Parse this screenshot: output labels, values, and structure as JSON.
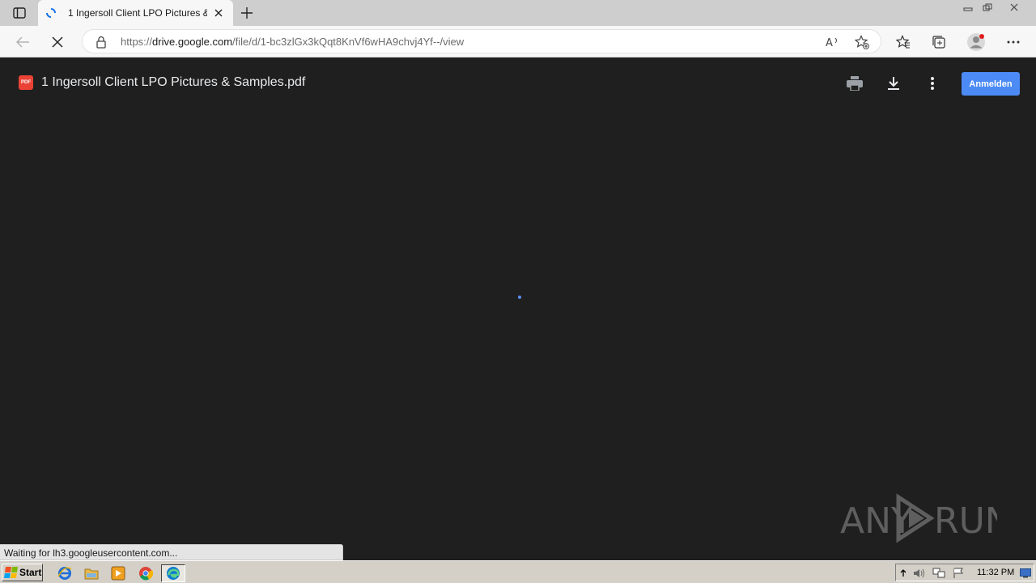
{
  "browser": {
    "tab": {
      "title": "1 Ingersoll Client LPO Pictures & Samples.pdf"
    },
    "address": {
      "url_prefix": "https://",
      "url_host": "drive.google.com",
      "url_path": "/file/d/1-bc3zlGx3kQqt8KnVf6wHA9chvj4Yf--/view"
    },
    "status_text": "Waiting for lh3.googleusercontent.com..."
  },
  "viewer": {
    "file_badge": "PDF",
    "title": "1 Ingersoll Client LPO Pictures & Samples.pdf",
    "sign_in_label": "Anmelden"
  },
  "watermark": {
    "text_left": "ANY",
    "text_right": "RUN"
  },
  "taskbar": {
    "start_label": "Start",
    "clock": "11:32 PM",
    "apps": [
      "internet-explorer",
      "file-explorer",
      "media-player",
      "chrome",
      "edge"
    ]
  },
  "colors": {
    "viewer_background": "#1f1f1f",
    "sign_in_button": "#4c8bf5",
    "pdf_badge": "#ea4335"
  }
}
